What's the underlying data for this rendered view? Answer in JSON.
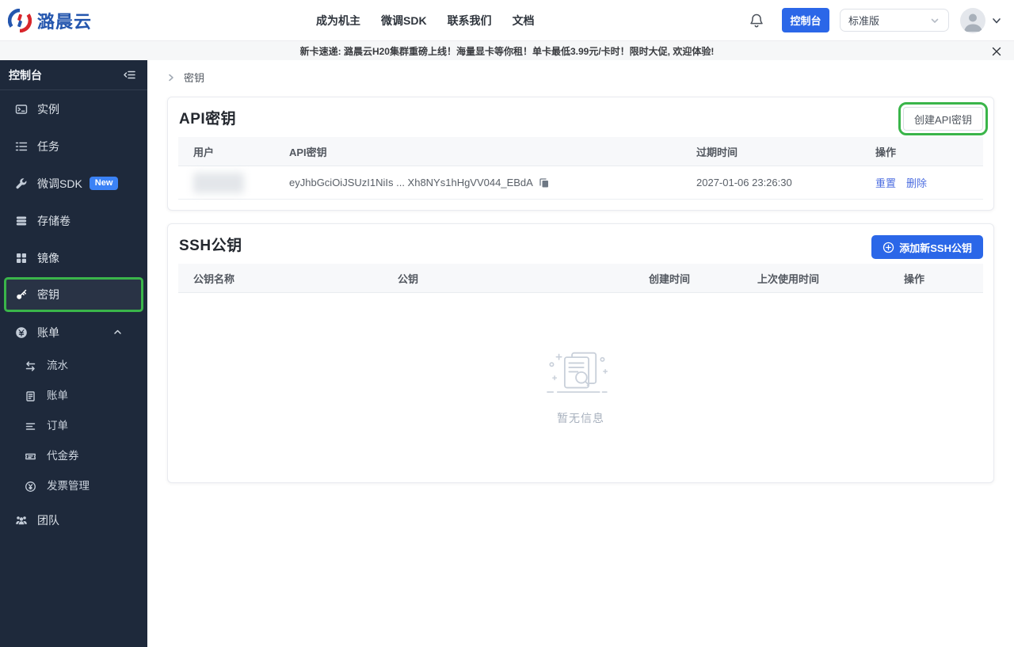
{
  "brand": {
    "name": "潞晨云"
  },
  "nav": {
    "items": [
      "成为机主",
      "微调SDK",
      "联系我们",
      "文档"
    ],
    "console_button": "控制台",
    "plan_select": "标准版"
  },
  "banner": {
    "text": "新卡速递: 潞晨云H20集群重磅上线！海量显卡等你租！单卡最低3.99元/卡时！限时大促, 欢迎体验!"
  },
  "sidebar": {
    "title": "控制台",
    "items": [
      {
        "icon": "terminal-icon",
        "label": "实例"
      },
      {
        "icon": "tasks-icon",
        "label": "任务"
      },
      {
        "icon": "wrench-icon",
        "label": "微调SDK",
        "badge": "New"
      },
      {
        "icon": "storage-icon",
        "label": "存储卷"
      },
      {
        "icon": "grid-icon",
        "label": "镜像"
      },
      {
        "icon": "key-icon",
        "label": "密钥",
        "selected": true
      },
      {
        "icon": "yuan-circle-icon",
        "label": "账单",
        "expanded": true
      },
      {
        "icon": "transfer-icon",
        "label": "流水",
        "sub": true
      },
      {
        "icon": "bill-icon",
        "label": "账单",
        "sub": true
      },
      {
        "icon": "order-icon",
        "label": "订单",
        "sub": true
      },
      {
        "icon": "voucher-icon",
        "label": "代金券",
        "sub": true
      },
      {
        "icon": "invoice-icon",
        "label": "发票管理",
        "sub": true
      },
      {
        "icon": "team-icon",
        "label": "团队"
      }
    ]
  },
  "breadcrumb": {
    "current": "密钥"
  },
  "api_card": {
    "title": "API密钥",
    "create_button": "创建API密钥",
    "table": {
      "headers": [
        "用户",
        "API密钥",
        "过期时间",
        "操作"
      ],
      "row": {
        "user": "",
        "api_key": "eyJhbGciOiJSUzI1NiIs ... Xh8NYs1hHgVV044_EBdA",
        "expires": "2027-01-06 23:26:30",
        "actions": [
          "重置",
          "删除"
        ]
      }
    }
  },
  "ssh_card": {
    "title": "SSH公钥",
    "add_button": "添加新SSH公钥",
    "table": {
      "headers": [
        "公钥名称",
        "公钥",
        "创建时间",
        "上次使用时间",
        "操作"
      ]
    },
    "empty_text": "暂无信息"
  },
  "colors": {
    "primary_blue": "#2b67e8",
    "link_blue": "#4d6ee0",
    "sidebar_bg": "#1e293b",
    "badge_blue": "#3b82f6",
    "annotation_green": "#3ab54a",
    "logo_blue": "#2456ae",
    "logo_red": "#d8262c"
  }
}
